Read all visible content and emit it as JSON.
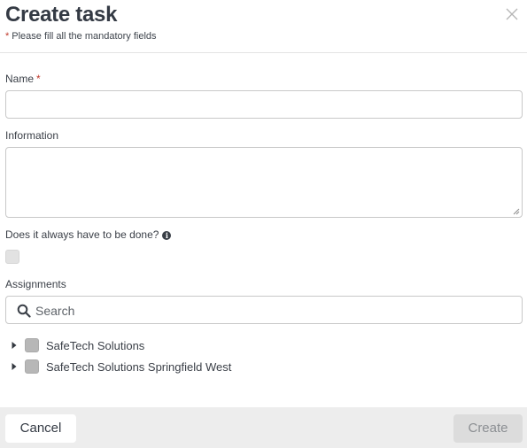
{
  "header": {
    "title": "Create task",
    "mandatory_star": "*",
    "mandatory_note": "Please fill all the mandatory fields"
  },
  "form": {
    "name_label": "Name",
    "name_required": "*",
    "name_value": "",
    "information_label": "Information",
    "information_value": "",
    "always_done_label": "Does it always have to be done?",
    "always_done_checked": false,
    "assignments_label": "Assignments"
  },
  "search": {
    "placeholder": "Search",
    "icon": "search-icon"
  },
  "tree": {
    "items": [
      {
        "label": "SafeTech Solutions",
        "checked": false,
        "expanded": false
      },
      {
        "label": "SafeTech Solutions Springfield West",
        "checked": false,
        "expanded": false
      }
    ]
  },
  "footer": {
    "cancel_label": "Cancel",
    "create_label": "Create"
  },
  "colors": {
    "required": "#c0392b",
    "text": "#343a44",
    "footer_bg": "#ededed",
    "disabled_button": "#dcdcdc"
  }
}
